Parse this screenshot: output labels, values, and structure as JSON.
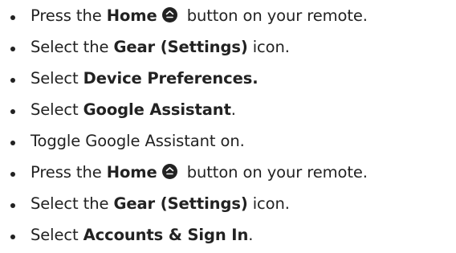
{
  "steps": [
    {
      "pre": "Press the ",
      "bold": "Home",
      "post": " button on your remote.",
      "icon": "home-button-icon"
    },
    {
      "pre": "Select the ",
      "bold": "Gear (Settings)",
      "post": " icon."
    },
    {
      "pre": "Select ",
      "bold": "Device Preferences.",
      "post": ""
    },
    {
      "pre": "Select ",
      "bold": "Google Assistant",
      "post": "."
    },
    {
      "pre": "Toggle Google Assistant on.",
      "bold": "",
      "post": ""
    },
    {
      "pre": "Press the ",
      "bold": "Home",
      "post": " button on your remote.",
      "icon": "home-button-icon"
    },
    {
      "pre": "Select the ",
      "bold": "Gear (Settings)",
      "post": " icon."
    },
    {
      "pre": "Select ",
      "bold": "Accounts & Sign In",
      "post": "."
    }
  ],
  "colors": {
    "text": "#222222",
    "background": "#ffffff"
  }
}
